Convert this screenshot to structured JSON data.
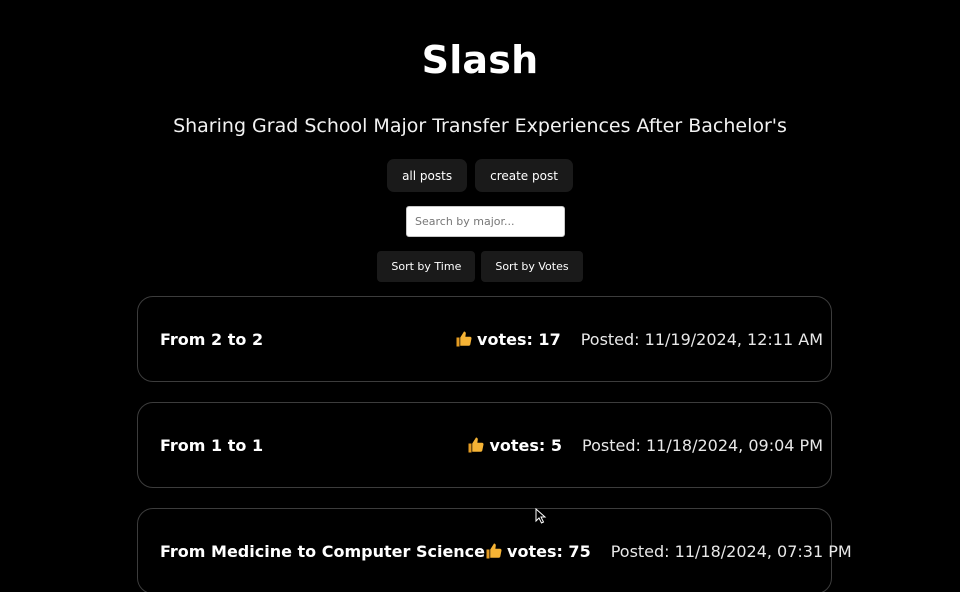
{
  "header": {
    "title": "Slash",
    "subtitle": "Sharing Grad School Major Transfer Experiences After Bachelor's"
  },
  "nav": {
    "all_posts": "all posts",
    "create_post": "create post"
  },
  "search": {
    "placeholder": "Search by major...",
    "value": ""
  },
  "sort": {
    "by_time": "Sort by Time",
    "by_votes": "Sort by Votes"
  },
  "posts": [
    {
      "title": "From 2 to 2",
      "votes": "votes: 17",
      "posted": "Posted: 11/19/2024, 12:11 AM",
      "icon": "thumbs-up-icon"
    },
    {
      "title": "From 1 to 1",
      "votes": "votes: 5",
      "posted": "Posted: 11/18/2024, 09:04 PM",
      "icon": "thumbs-up-icon"
    },
    {
      "title": "From Medicine to Computer Science",
      "votes": "votes: 75",
      "posted": "Posted: 11/18/2024, 07:31 PM",
      "icon": "thumbs-up-icon"
    }
  ],
  "colors": {
    "background": "#000000",
    "button_bg": "#1a1a1a",
    "card_border": "#3c3c3c",
    "thumb": "#f5b335"
  }
}
